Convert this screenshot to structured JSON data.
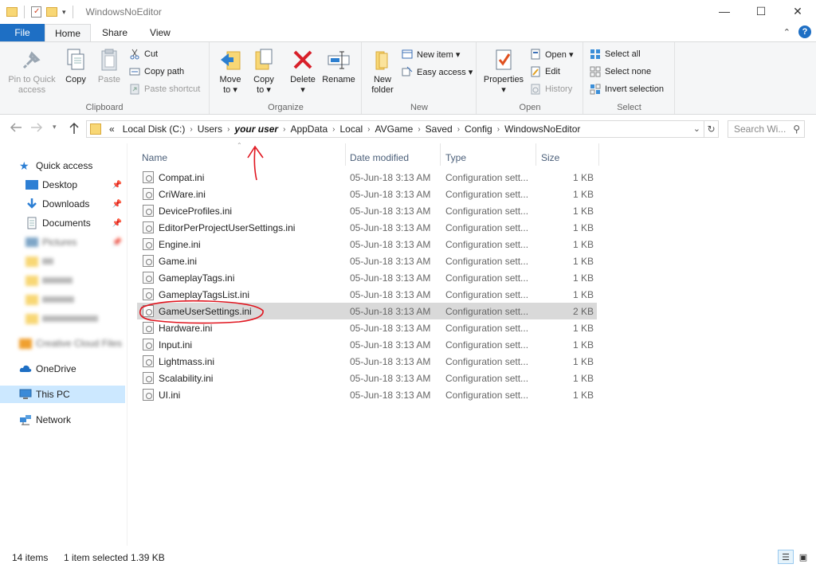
{
  "window": {
    "title": "WindowsNoEditor",
    "controls": {
      "minimize": "—",
      "maximize": "☐",
      "close": "✕"
    }
  },
  "ribbon_tabs": [
    "File",
    "Home",
    "Share",
    "View"
  ],
  "ribbon": {
    "clipboard": {
      "label": "Clipboard",
      "pin_line1": "Pin to Quick",
      "pin_line2": "access",
      "copy": "Copy",
      "paste": "Paste",
      "cut": "Cut",
      "copy_path": "Copy path",
      "paste_shortcut": "Paste shortcut"
    },
    "organize": {
      "label": "Organize",
      "move_to": "Move",
      "move_to_2": "to ▾",
      "copy_to": "Copy",
      "copy_to_2": "to ▾",
      "delete": "Delete",
      "delete_2": "▾",
      "rename": "Rename"
    },
    "new": {
      "label": "New",
      "new_folder_1": "New",
      "new_folder_2": "folder",
      "new_item": "New item ▾",
      "easy_access": "Easy access ▾"
    },
    "open": {
      "label": "Open",
      "properties": "Properties",
      "properties_2": "▾",
      "open": "Open ▾",
      "edit": "Edit",
      "history": "History"
    },
    "select": {
      "label": "Select",
      "select_all": "Select all",
      "select_none": "Select none",
      "invert": "Invert selection"
    }
  },
  "address": {
    "overflow": "«",
    "crumbs": [
      "Local Disk (C:)",
      "Users",
      "your user",
      "AppData",
      "Local",
      "AVGame",
      "Saved",
      "Config",
      "WindowsNoEditor"
    ]
  },
  "search": {
    "placeholder": "Search Wi..."
  },
  "nav_pane": {
    "quick_access": "Quick access",
    "desktop": "Desktop",
    "downloads": "Downloads",
    "documents": "Documents",
    "pictures": "Pictures",
    "creative_cloud": "Creative Cloud Files",
    "onedrive": "OneDrive",
    "this_pc": "This PC",
    "network": "Network"
  },
  "columns": {
    "name": "Name",
    "date": "Date modified",
    "type": "Type",
    "size": "Size"
  },
  "files": [
    {
      "name": "Compat.ini",
      "date": "05-Jun-18 3:13 AM",
      "type": "Configuration sett...",
      "size": "1 KB"
    },
    {
      "name": "CriWare.ini",
      "date": "05-Jun-18 3:13 AM",
      "type": "Configuration sett...",
      "size": "1 KB"
    },
    {
      "name": "DeviceProfiles.ini",
      "date": "05-Jun-18 3:13 AM",
      "type": "Configuration sett...",
      "size": "1 KB"
    },
    {
      "name": "EditorPerProjectUserSettings.ini",
      "date": "05-Jun-18 3:13 AM",
      "type": "Configuration sett...",
      "size": "1 KB"
    },
    {
      "name": "Engine.ini",
      "date": "05-Jun-18 3:13 AM",
      "type": "Configuration sett...",
      "size": "1 KB"
    },
    {
      "name": "Game.ini",
      "date": "05-Jun-18 3:13 AM",
      "type": "Configuration sett...",
      "size": "1 KB"
    },
    {
      "name": "GameplayTags.ini",
      "date": "05-Jun-18 3:13 AM",
      "type": "Configuration sett...",
      "size": "1 KB"
    },
    {
      "name": "GameplayTagsList.ini",
      "date": "05-Jun-18 3:13 AM",
      "type": "Configuration sett...",
      "size": "1 KB"
    },
    {
      "name": "GameUserSettings.ini",
      "date": "05-Jun-18 3:13 AM",
      "type": "Configuration sett...",
      "size": "2 KB",
      "selected": true
    },
    {
      "name": "Hardware.ini",
      "date": "05-Jun-18 3:13 AM",
      "type": "Configuration sett...",
      "size": "1 KB"
    },
    {
      "name": "Input.ini",
      "date": "05-Jun-18 3:13 AM",
      "type": "Configuration sett...",
      "size": "1 KB"
    },
    {
      "name": "Lightmass.ini",
      "date": "05-Jun-18 3:13 AM",
      "type": "Configuration sett...",
      "size": "1 KB"
    },
    {
      "name": "Scalability.ini",
      "date": "05-Jun-18 3:13 AM",
      "type": "Configuration sett...",
      "size": "1 KB"
    },
    {
      "name": "UI.ini",
      "date": "05-Jun-18 3:13 AM",
      "type": "Configuration sett...",
      "size": "1 KB"
    }
  ],
  "status": {
    "count": "14 items",
    "selection": "1 item selected  1.39 KB"
  },
  "colors": {
    "accent": "#1e6fc4",
    "selected_row": "#d9d9d9",
    "nav_selected": "#cce8ff",
    "annotation": "#e0141e"
  },
  "icons": {
    "back": "arrow-left-icon",
    "forward": "arrow-right-icon",
    "up": "arrow-up-icon",
    "refresh": "refresh-icon",
    "search": "search-icon",
    "file": "ini-settings-file-icon"
  }
}
